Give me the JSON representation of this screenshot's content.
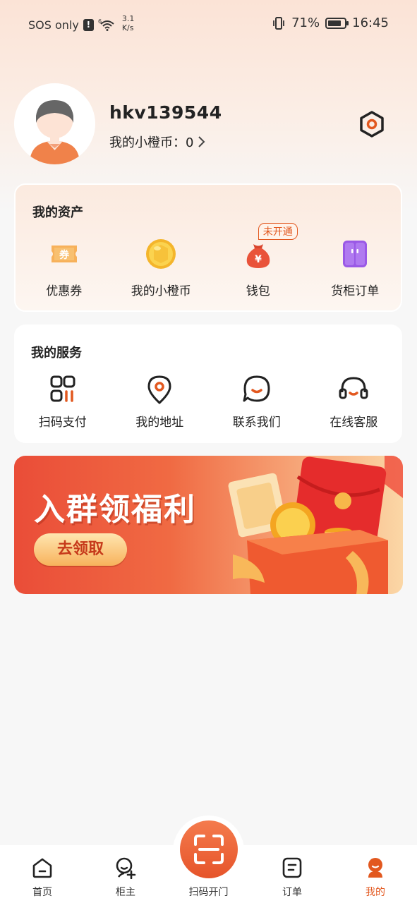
{
  "status_bar": {
    "carrier": "SOS only",
    "alert": "!",
    "network_speed_value": "3.1",
    "network_speed_unit": "K/s",
    "battery": "71%",
    "time": "16:45"
  },
  "profile": {
    "username": "hkv139544",
    "coin_label": "我的小橙币：0",
    "coin_chevron": "›"
  },
  "assets": {
    "title": "我的资产",
    "items": [
      {
        "label": "优惠券",
        "icon": "coupon-icon",
        "icon_text": "券"
      },
      {
        "label": "我的小橙币",
        "icon": "coin-icon"
      },
      {
        "label": "钱包",
        "icon": "wallet-icon",
        "icon_text": "¥",
        "badge": "未开通"
      },
      {
        "label": "货柜订单",
        "icon": "locker-order-icon"
      }
    ]
  },
  "services": {
    "title": "我的服务",
    "items": [
      {
        "label": "扫码支付",
        "icon": "scan-pay-icon"
      },
      {
        "label": "我的地址",
        "icon": "location-icon"
      },
      {
        "label": "联系我们",
        "icon": "chat-icon"
      },
      {
        "label": "在线客服",
        "icon": "headset-icon"
      }
    ]
  },
  "banner": {
    "title": "入群领福利",
    "button": "去领取"
  },
  "bottom_nav": {
    "items": [
      {
        "label": "首页",
        "icon": "home-icon"
      },
      {
        "label": "柜主",
        "icon": "owner-icon"
      },
      {
        "label": "扫码开门",
        "icon": "scan-icon"
      },
      {
        "label": "订单",
        "icon": "order-icon"
      },
      {
        "label": "我的",
        "icon": "me-icon",
        "active": true
      }
    ]
  },
  "colors": {
    "accent": "#e2581f",
    "banner_red": "#ea4d38",
    "background": "#f7f7f7"
  }
}
